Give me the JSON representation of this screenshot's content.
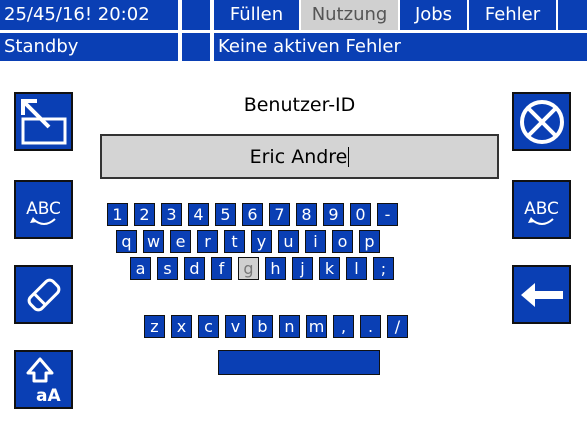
{
  "status": {
    "datetime": "25/45/16! 20:02",
    "state": "Standby",
    "message": "Keine aktiven Fehler"
  },
  "tabs": [
    {
      "label": "Füllen",
      "active": false
    },
    {
      "label": "Nutzung",
      "active": true
    },
    {
      "label": "Jobs",
      "active": false
    },
    {
      "label": "Fehler",
      "active": false
    }
  ],
  "entry": {
    "title": "Benutzer-ID",
    "value": "Eric Andre"
  },
  "side_buttons": {
    "abc_label": "ABC"
  },
  "keyboard": {
    "row1": [
      "1",
      "2",
      "3",
      "4",
      "5",
      "6",
      "7",
      "8",
      "9",
      "0",
      "-"
    ],
    "row2": [
      "q",
      "w",
      "e",
      "r",
      "t",
      "y",
      "u",
      "i",
      "o",
      "p"
    ],
    "row3": [
      "a",
      "s",
      "d",
      "f",
      "g",
      "h",
      "j",
      "k",
      "l",
      ";"
    ],
    "row4": [
      "z",
      "x",
      "c",
      "v",
      "b",
      "n",
      "m",
      ",",
      ".",
      "/"
    ],
    "selected": "g"
  },
  "colors": {
    "button_blue": "#0a3fb4",
    "selected_gray": "#d0d0d0",
    "field_gray": "#d4d4d4"
  }
}
